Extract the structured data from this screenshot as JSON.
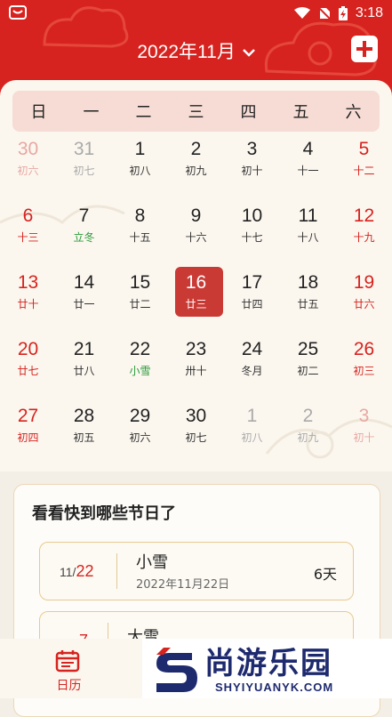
{
  "status": {
    "time": "3:18"
  },
  "header": {
    "month_title": "2022年11月"
  },
  "weekdays": [
    "日",
    "一",
    "二",
    "三",
    "四",
    "五",
    "六"
  ],
  "calendar": {
    "rows": [
      [
        {
          "n": "30",
          "l": "初六"
        },
        {
          "n": "31",
          "l": "初七"
        },
        {
          "n": "1",
          "l": "初八"
        },
        {
          "n": "2",
          "l": "初九"
        },
        {
          "n": "3",
          "l": "初十"
        },
        {
          "n": "4",
          "l": "十一"
        },
        {
          "n": "5",
          "l": "十二"
        }
      ],
      [
        {
          "n": "6",
          "l": "十三"
        },
        {
          "n": "7",
          "l": "立冬"
        },
        {
          "n": "8",
          "l": "十五"
        },
        {
          "n": "9",
          "l": "十六"
        },
        {
          "n": "10",
          "l": "十七"
        },
        {
          "n": "11",
          "l": "十八"
        },
        {
          "n": "12",
          "l": "十九"
        }
      ],
      [
        {
          "n": "13",
          "l": "廿十"
        },
        {
          "n": "14",
          "l": "廿一"
        },
        {
          "n": "15",
          "l": "廿二"
        },
        {
          "n": "16",
          "l": "廿三"
        },
        {
          "n": "17",
          "l": "廿四"
        },
        {
          "n": "18",
          "l": "廿五"
        },
        {
          "n": "19",
          "l": "廿六"
        }
      ],
      [
        {
          "n": "20",
          "l": "廿七"
        },
        {
          "n": "21",
          "l": "廿八"
        },
        {
          "n": "22",
          "l": "小雪"
        },
        {
          "n": "23",
          "l": "卅十"
        },
        {
          "n": "24",
          "l": "冬月"
        },
        {
          "n": "25",
          "l": "初二"
        },
        {
          "n": "26",
          "l": "初三"
        }
      ],
      [
        {
          "n": "27",
          "l": "初四"
        },
        {
          "n": "28",
          "l": "初五"
        },
        {
          "n": "29",
          "l": "初六"
        },
        {
          "n": "30",
          "l": "初七"
        },
        {
          "n": "1",
          "l": "初八"
        },
        {
          "n": "2",
          "l": "初九"
        },
        {
          "n": "3",
          "l": "初十"
        }
      ]
    ],
    "selected_day": "16"
  },
  "festivals": {
    "title": "看看快到哪些节日了",
    "items": [
      {
        "month": "11/",
        "day": "22",
        "name": "小雪",
        "full_date": "2022年11月22日",
        "countdown": "6天"
      },
      {
        "month": "",
        "day": "7",
        "name": "大雪",
        "full_date": "",
        "countdown": ""
      }
    ]
  },
  "tabbar": {
    "calendar_label": "日历"
  },
  "watermark": {
    "text": "尚游乐园",
    "url": "SHYIYUANYK.COM"
  },
  "colors": {
    "accent": "#d7231f",
    "term": "#2a9a3a",
    "selected_bg": "#c93a35"
  }
}
